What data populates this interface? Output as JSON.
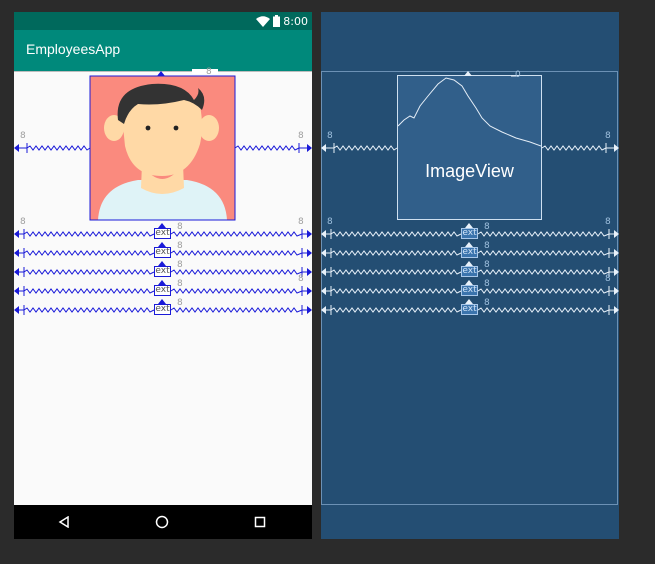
{
  "device": {
    "status_time": "8:00",
    "app_title": "EmployeesApp"
  },
  "blueprint": {
    "image_view_label": "ImageView"
  },
  "constraints": {
    "margin_value": "8",
    "top_margin_value": "0",
    "textview_placeholder": "ext"
  },
  "colors": {
    "status_bar": "#00695c",
    "app_bar": "#00897b",
    "constraint_blue": "#1a1ad8",
    "blueprint_bg": "#244e73",
    "avatar_bg": "#fa8a7e"
  },
  "icons": {
    "wifi": "wifi-icon",
    "battery": "battery-icon",
    "back": "back-triangle-icon",
    "home": "home-circle-icon",
    "recents": "recents-square-icon"
  }
}
